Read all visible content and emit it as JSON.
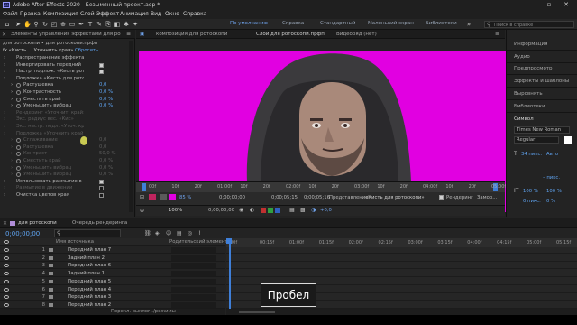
{
  "window": {
    "title": "Adobe After Effects 2020 - Безымянный проект.aep *",
    "app_icon_text": "Ae",
    "minimize": "–",
    "maximize": "▫",
    "close": "✕"
  },
  "menu": [
    "Файл",
    "Правка",
    "Композиция",
    "Слой",
    "Эффект",
    "Анимация",
    "Вид",
    "Окно",
    "Справка"
  ],
  "workspaces": [
    "По умолчанию",
    "Справка",
    "Стандартный",
    "Маленький экран",
    "Библиотеки"
  ],
  "search_placeholder": "Поиск в справке",
  "effects_panel": {
    "tab": "Элементы управления эффектами для ро",
    "layer_path": "для ротоскопи • для ротоскопи.прфп",
    "effect_header": "fx  «Кисть ... Уточнить края»",
    "reset_label": "Сбросить",
    "rows": [
      {
        "label": "Распространение эффекта «Кисть",
        "value": "",
        "dim": false
      },
      {
        "label": "Инвертировать передний",
        "value": "",
        "dim": false
      },
      {
        "label": "Настр. подлож. «Кисть рот",
        "value": "",
        "dim": false
      },
      {
        "label": "Подложка «Кисть для ротоскопи",
        "value": "",
        "dim": false
      },
      {
        "label": "Растушевка",
        "value": "0,0",
        "dim": false
      },
      {
        "label": "Контрастность",
        "value": "0,0 %",
        "dim": false
      },
      {
        "label": "Сместить край",
        "value": "0,0 %",
        "dim": false
      },
      {
        "label": "Уменьшить вибрац",
        "value": "0,0 %",
        "dim": false
      },
      {
        "label": "Рендеринг «Уточнит. край»",
        "value": "",
        "dim": true
      },
      {
        "label": "Экс. радиус вес. «Кис»",
        "value": "",
        "dim": true
      },
      {
        "label": "Экс. настр. подл. «Уточ. кр",
        "value": "",
        "dim": true
      },
      {
        "label": "Подложка «Уточнить край»",
        "value": "",
        "dim": true
      },
      {
        "label": "Сглаживание",
        "value": "0,0",
        "dim": true
      },
      {
        "label": "Растушевка",
        "value": "0,0",
        "dim": true
      },
      {
        "label": "Контраст",
        "value": "50,0 %",
        "dim": true
      },
      {
        "label": "Сместить край",
        "value": "0,0 %",
        "dim": true
      },
      {
        "label": "Уменьшить вибрац",
        "value": "0,0 %",
        "dim": true
      },
      {
        "label": "Уменьшить вибрац",
        "value": "0,0 %",
        "dim": true
      },
      {
        "label": "Использовать размытие в",
        "value": "",
        "dim": false
      },
      {
        "label": "Размытие в движении",
        "value": "",
        "dim": true
      },
      {
        "label": "Очистка цветов края",
        "value": "",
        "dim": false
      }
    ]
  },
  "comp_panel": {
    "tabs": [
      "композиция для ротоскопи",
      "Слой для ротоскопи.прфп",
      "Видеоряд (нет)"
    ],
    "ruler_ticks": [
      "00f",
      "10f",
      "20f",
      "01:00f",
      "10f",
      "20f",
      "02:00f",
      "10f",
      "20f",
      "03:00f",
      "10f",
      "20f",
      "04:00f",
      "10f",
      "20f",
      "05:00f"
    ],
    "zoom": "100%",
    "timecode_a": "0;00;00;00",
    "timecode_b": "0;00;00;00",
    "timecode_c": "0;00;05;15",
    "timecode_d": "0;00;05;16",
    "display_label": "Представление:",
    "display_value": "«Кисть для ротоскопи»",
    "render_label": "Рендеринг",
    "refine_label": "Замор...",
    "percent": "85 %",
    "exposure": "+0,0"
  },
  "right_panel": {
    "items": [
      "Информация",
      "Аудио",
      "Предпросмотр",
      "Эффекты и шаблоны",
      "Выровнять",
      "Библиотеки",
      "Символ"
    ],
    "font": "Times New Roman",
    "style": "Regular",
    "size": "34 пикс.",
    "leading": "Авто",
    "tracking": "– пикс.",
    "scale_v": "100 %",
    "scale_h": "100 %",
    "baseline": "0 пикс.",
    "tsume": "0 %"
  },
  "timeline": {
    "tabs": [
      "для ротоскопи",
      "Очередь рендеринга"
    ],
    "timecode": "0;00;00;00",
    "fps_note": "00000 (29,97 кадр/с)",
    "col_layer": "Имя источника",
    "col_parent": "Родительский элемент...",
    "layers": [
      {
        "num": "1",
        "name": "Передний план 7"
      },
      {
        "num": "2",
        "name": "Задний план 2"
      },
      {
        "num": "3",
        "name": "Передний план 6"
      },
      {
        "num": "4",
        "name": "Задний план 1"
      },
      {
        "num": "5",
        "name": "Передний план 5"
      },
      {
        "num": "6",
        "name": "Передний план 4"
      },
      {
        "num": "7",
        "name": "Передний план 3"
      },
      {
        "num": "8",
        "name": "Передний план 2"
      }
    ],
    "ticks": [
      "00f",
      "00:15f",
      "01:00f",
      "01:15f",
      "02:00f",
      "02:15f",
      "03:00f",
      "03:15f",
      "04:00f",
      "04:15f",
      "05:00f",
      "05:15f"
    ],
    "footer": "Перекл. выключ./режимы"
  },
  "overlay_key": "Пробел",
  "colors": {
    "magenta_bg": "#e100e1",
    "accent_blue": "#5fa3f0",
    "panel": "#232323"
  }
}
